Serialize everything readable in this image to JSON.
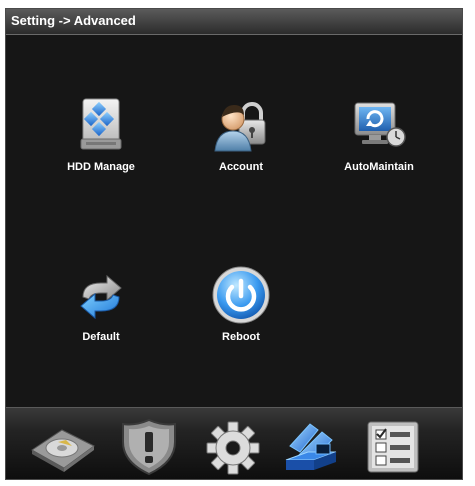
{
  "window": {
    "title": "Setting -> Advanced"
  },
  "items": [
    {
      "label": "HDD Manage",
      "icon": "hdd-manage-icon"
    },
    {
      "label": "Account",
      "icon": "account-icon"
    },
    {
      "label": "AutoMaintain",
      "icon": "automaintain-icon"
    },
    {
      "label": "Default",
      "icon": "default-icon"
    },
    {
      "label": "Reboot",
      "icon": "reboot-icon"
    }
  ],
  "bottom_bar": {
    "icons": [
      "disk-icon",
      "shield-alert-icon",
      "gear-icon",
      "advanced-icon",
      "checklist-icon"
    ],
    "active_index": 3
  },
  "colors": {
    "background": "#161616",
    "text": "#ffffff",
    "accent": "#3a8fe8"
  }
}
